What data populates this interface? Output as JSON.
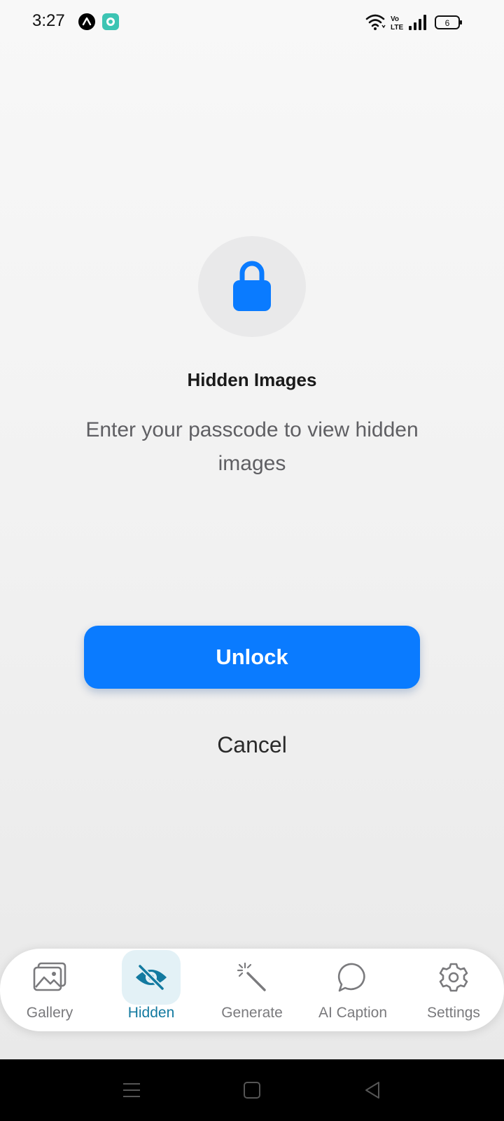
{
  "status_bar": {
    "time": "3:27",
    "battery_level": "6",
    "icons": [
      "app-a-icon",
      "chat-app-icon",
      "wifi-icon",
      "volte-icon",
      "signal-icon",
      "battery-icon"
    ]
  },
  "main": {
    "lock_icon": "lock-icon",
    "title": "Hidden Images",
    "subtitle": "Enter your passcode to view hidden images",
    "passcode": {
      "value": "",
      "placeholder": ""
    },
    "unlock_label": "Unlock",
    "cancel_label": "Cancel"
  },
  "tab_bar": {
    "active": "Hidden",
    "tabs": [
      {
        "label": "Gallery",
        "icon": "gallery-icon"
      },
      {
        "label": "Hidden",
        "icon": "eye-off-icon"
      },
      {
        "label": "Generate",
        "icon": "magic-wand-icon"
      },
      {
        "label": "AI Caption",
        "icon": "chat-bubble-icon"
      },
      {
        "label": "Settings",
        "icon": "gear-icon"
      }
    ]
  },
  "colors": {
    "accent": "#0a7bff",
    "tab_active": "#137aa0",
    "tab_active_bg": "#e3f1f6",
    "tab_inactive": "#7a7a7d"
  },
  "nav_bar": {
    "buttons": [
      "menu-icon",
      "home-icon",
      "back-icon"
    ]
  }
}
